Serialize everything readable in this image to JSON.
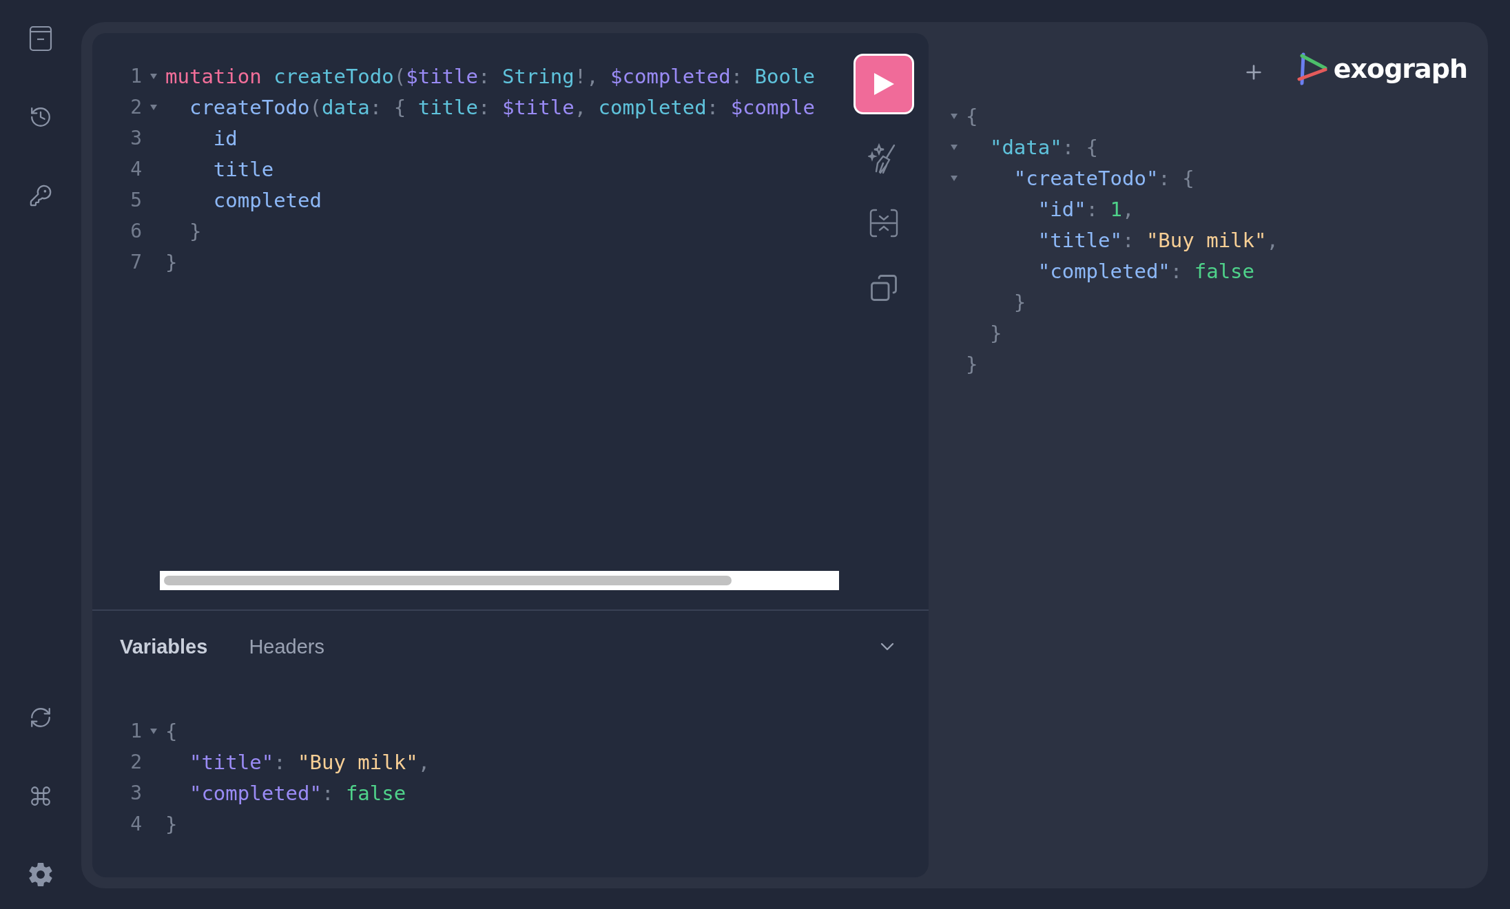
{
  "query_editor": {
    "lines": [
      {
        "number": "1",
        "foldable": true,
        "tokens": [
          {
            "kind": "keyword",
            "text": "mutation"
          },
          {
            "kind": "def",
            "text": " createTodo"
          },
          {
            "kind": "punct",
            "text": "("
          },
          {
            "kind": "variable",
            "text": "$title"
          },
          {
            "kind": "punct",
            "text": ": "
          },
          {
            "kind": "type",
            "text": "String"
          },
          {
            "kind": "punct",
            "text": "!, "
          },
          {
            "kind": "variable",
            "text": "$completed"
          },
          {
            "kind": "punct",
            "text": ": "
          },
          {
            "kind": "type",
            "text": "Boole"
          }
        ]
      },
      {
        "number": "2",
        "foldable": true,
        "tokens": [
          {
            "kind": "field",
            "text": "  createTodo"
          },
          {
            "kind": "punct",
            "text": "("
          },
          {
            "kind": "attr",
            "text": "data"
          },
          {
            "kind": "punct",
            "text": ": { "
          },
          {
            "kind": "attr",
            "text": "title"
          },
          {
            "kind": "punct",
            "text": ": "
          },
          {
            "kind": "variable",
            "text": "$title"
          },
          {
            "kind": "punct",
            "text": ", "
          },
          {
            "kind": "attr",
            "text": "completed"
          },
          {
            "kind": "punct",
            "text": ": "
          },
          {
            "kind": "variable",
            "text": "$comple"
          }
        ]
      },
      {
        "number": "3",
        "foldable": false,
        "tokens": [
          {
            "kind": "field",
            "text": "    id"
          }
        ]
      },
      {
        "number": "4",
        "foldable": false,
        "tokens": [
          {
            "kind": "field",
            "text": "    title"
          }
        ]
      },
      {
        "number": "5",
        "foldable": false,
        "tokens": [
          {
            "kind": "field",
            "text": "    completed"
          }
        ]
      },
      {
        "number": "6",
        "foldable": false,
        "tokens": [
          {
            "kind": "punct",
            "text": "  }"
          }
        ]
      },
      {
        "number": "7",
        "foldable": false,
        "tokens": [
          {
            "kind": "punct",
            "text": "}"
          }
        ]
      }
    ]
  },
  "bottom_tabs": [
    {
      "label": "Variables",
      "selected": true
    },
    {
      "label": "Headers",
      "selected": false
    }
  ],
  "variables_editor": {
    "lines": [
      {
        "number": "1",
        "foldable": true,
        "tokens": [
          {
            "kind": "punct",
            "text": "{"
          }
        ]
      },
      {
        "number": "2",
        "foldable": false,
        "tokens": [
          {
            "kind": "variable",
            "text": "  \"title\""
          },
          {
            "kind": "punct",
            "text": ": "
          },
          {
            "kind": "string",
            "text": "\"Buy milk\""
          },
          {
            "kind": "punct",
            "text": ","
          }
        ]
      },
      {
        "number": "3",
        "foldable": false,
        "tokens": [
          {
            "kind": "variable",
            "text": "  \"completed\""
          },
          {
            "kind": "punct",
            "text": ": "
          },
          {
            "kind": "bool",
            "text": "false"
          }
        ]
      },
      {
        "number": "4",
        "foldable": false,
        "tokens": [
          {
            "kind": "punct",
            "text": "}"
          }
        ]
      }
    ]
  },
  "brand": {
    "name": "exograph"
  },
  "result": {
    "lines": [
      {
        "foldable": true,
        "tokens": [
          {
            "kind": "punct",
            "text": "{"
          }
        ]
      },
      {
        "foldable": true,
        "tokens": [
          {
            "kind": "attr",
            "text": "  \"data\""
          },
          {
            "kind": "punct",
            "text": ": {"
          }
        ]
      },
      {
        "foldable": true,
        "tokens": [
          {
            "kind": "field",
            "text": "    \"createTodo\""
          },
          {
            "kind": "punct",
            "text": ": {"
          }
        ]
      },
      {
        "foldable": false,
        "tokens": [
          {
            "kind": "field",
            "text": "      \"id\""
          },
          {
            "kind": "punct",
            "text": ": "
          },
          {
            "kind": "number",
            "text": "1"
          },
          {
            "kind": "punct",
            "text": ","
          }
        ]
      },
      {
        "foldable": false,
        "tokens": [
          {
            "kind": "field",
            "text": "      \"title\""
          },
          {
            "kind": "punct",
            "text": ": "
          },
          {
            "kind": "string",
            "text": "\"Buy milk\""
          },
          {
            "kind": "punct",
            "text": ","
          }
        ]
      },
      {
        "foldable": false,
        "tokens": [
          {
            "kind": "field",
            "text": "      \"completed\""
          },
          {
            "kind": "punct",
            "text": ": "
          },
          {
            "kind": "bool",
            "text": "false"
          }
        ]
      },
      {
        "foldable": false,
        "tokens": [
          {
            "kind": "punct",
            "text": "    }"
          }
        ]
      },
      {
        "foldable": false,
        "tokens": [
          {
            "kind": "punct",
            "text": "  }"
          }
        ]
      },
      {
        "foldable": false,
        "tokens": [
          {
            "kind": "punct",
            "text": "}"
          }
        ]
      }
    ]
  }
}
